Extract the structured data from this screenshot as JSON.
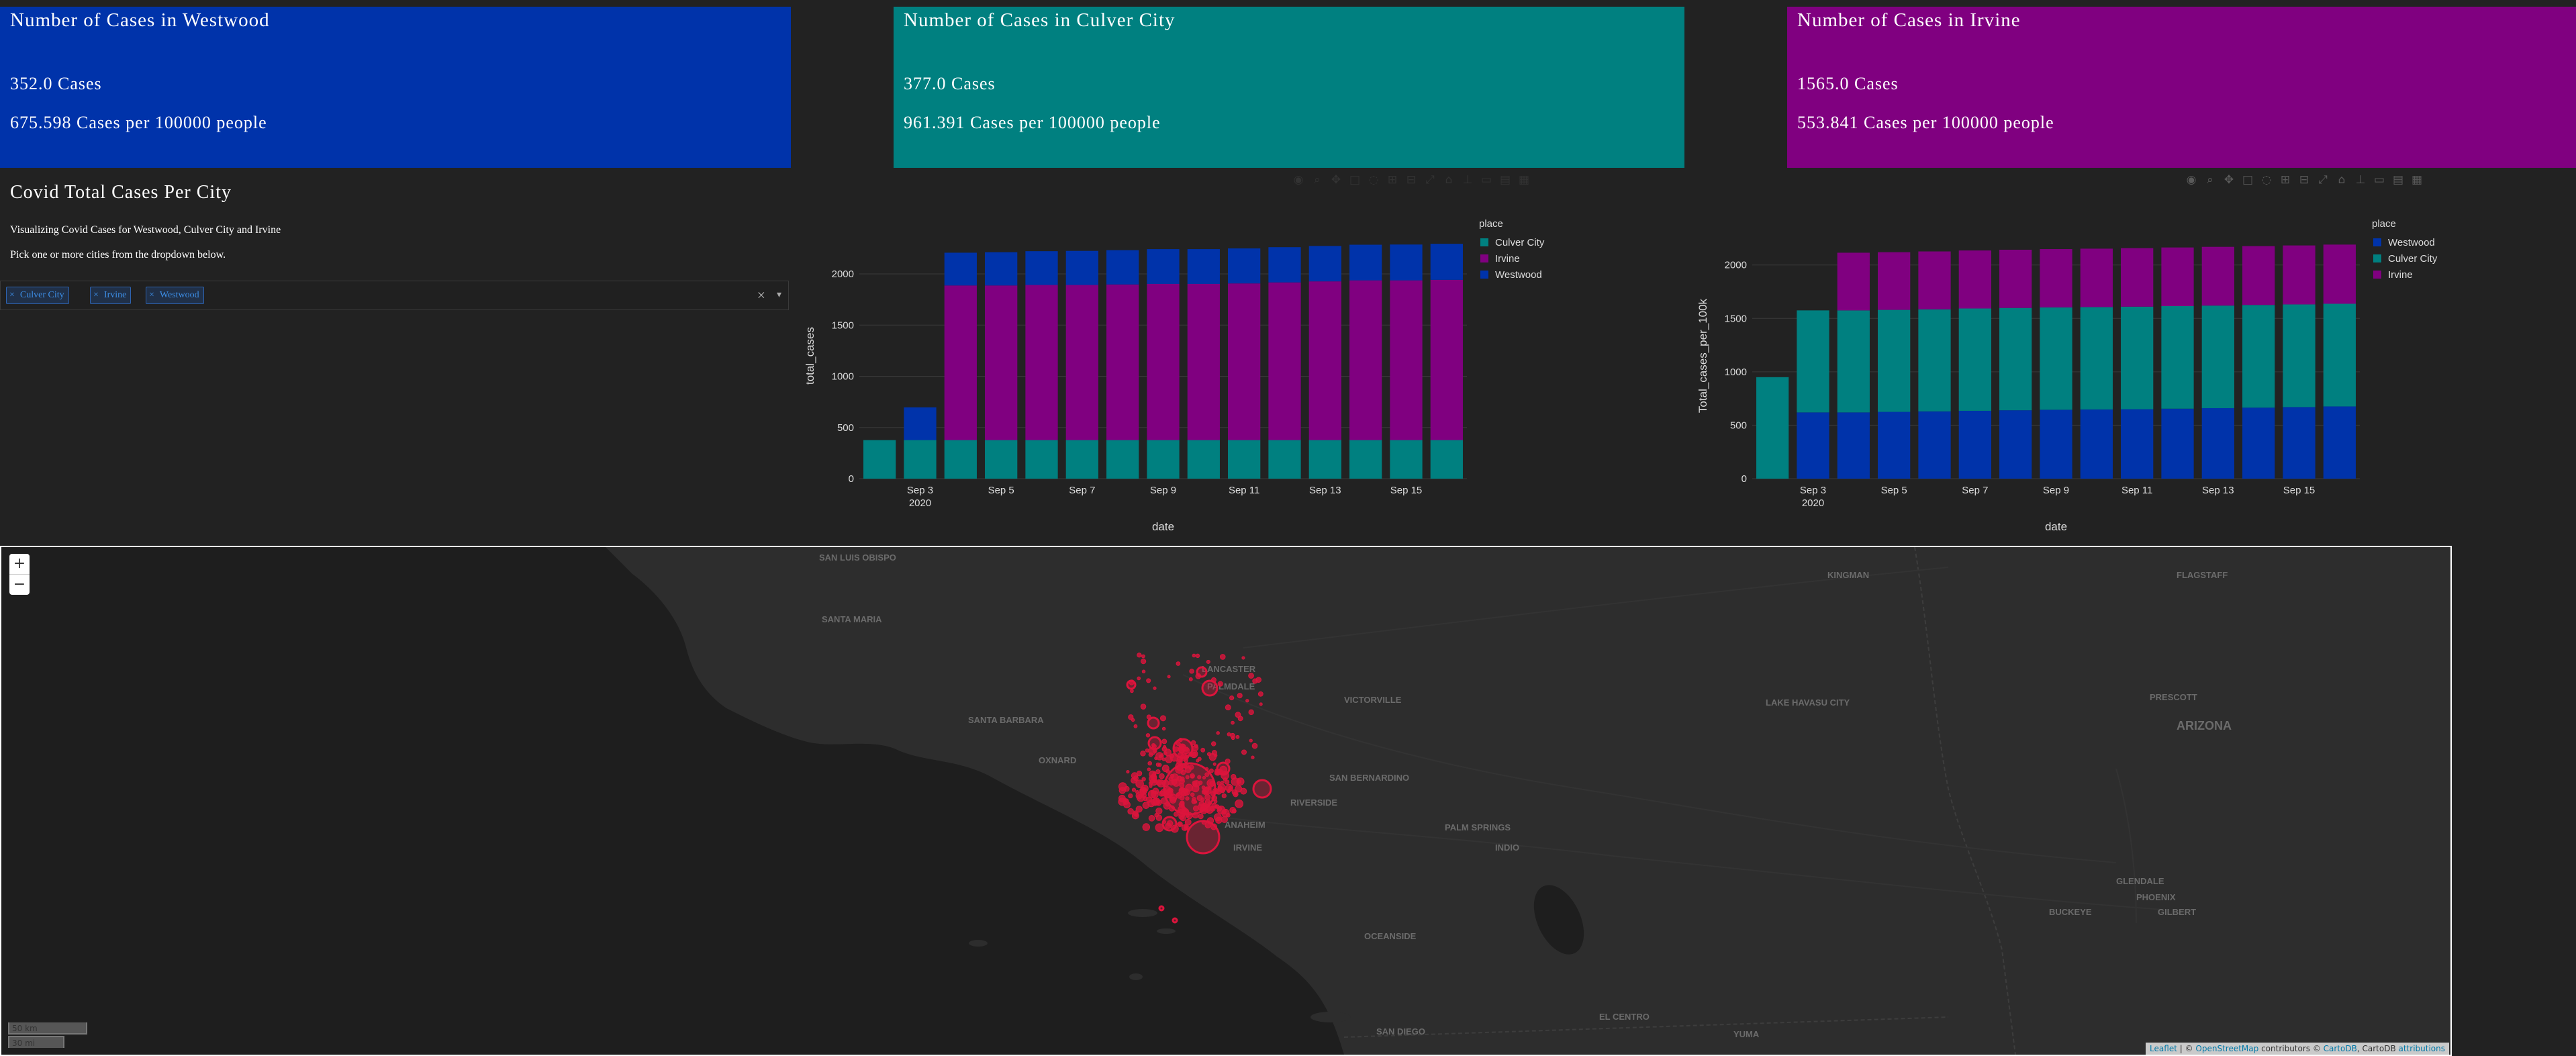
{
  "cards": [
    {
      "title": "Number of Cases in Westwood",
      "cases": "352.0 Cases",
      "per": "675.598 Cases per 100000 people",
      "color": "#0033aa"
    },
    {
      "title": "Number of Cases in Culver City",
      "cases": "377.0 Cases",
      "per": "961.391 Cases per 100000 people",
      "color": "#008080"
    },
    {
      "title": "Number of Cases in Irvine",
      "cases": "1565.0 Cases",
      "per": "553.841 Cases per 100000 people",
      "color": "#800080"
    }
  ],
  "intro": {
    "title": "Covid Total Cases Per City",
    "line1": "Visualizing Covid Cases for Westwood, Culver City and Irvine",
    "line2": "Pick one or more cities from the dropdown below."
  },
  "dropdown": {
    "chips": [
      "Culver City",
      "Irvine",
      "Westwood"
    ],
    "remove_glyph": "×",
    "clear_glyph": "×",
    "caret_glyph": "▾"
  },
  "colors": {
    "westwood": "#0033aa",
    "culver": "#008080",
    "irvine": "#800080"
  },
  "chart_data": [
    {
      "type": "bar",
      "stacked": true,
      "xlabel": "date",
      "ylabel": "total_cases",
      "legend_title": "place",
      "legend_position": "top-right",
      "grid": true,
      "ylim": [
        0,
        2400
      ],
      "yticks": [
        0,
        500,
        1000,
        1500,
        2000
      ],
      "x_tick_labels": [
        "Sep 3\n2020",
        "Sep 5",
        "Sep 7",
        "Sep 9",
        "Sep 11",
        "Sep 13",
        "Sep 15"
      ],
      "x_tick_days": [
        3,
        5,
        7,
        9,
        11,
        13,
        15
      ],
      "x": [
        "2020-09-02",
        "2020-09-03",
        "2020-09-04",
        "2020-09-05",
        "2020-09-06",
        "2020-09-07",
        "2020-09-08",
        "2020-09-09",
        "2020-09-10",
        "2020-09-11",
        "2020-09-12",
        "2020-09-13",
        "2020-09-14",
        "2020-09-15",
        "2020-09-16"
      ],
      "series": [
        {
          "name": "Culver City",
          "color": "#008080",
          "values": [
            377,
            377,
            377,
            377,
            377,
            377,
            377,
            377,
            377,
            377,
            377,
            377,
            377,
            377,
            377
          ]
        },
        {
          "name": "Irvine",
          "color": "#800080",
          "values": [
            0,
            0,
            1510,
            1510,
            1515,
            1515,
            1520,
            1525,
            1525,
            1530,
            1540,
            1550,
            1560,
            1560,
            1565
          ]
        },
        {
          "name": "Westwood",
          "color": "#0033aa",
          "values": [
            0,
            320,
            320,
            325,
            330,
            333,
            335,
            340,
            340,
            342,
            344,
            346,
            348,
            350,
            352
          ]
        }
      ]
    },
    {
      "type": "bar",
      "stacked": true,
      "xlabel": "date",
      "ylabel": "Total_cases_per_100k",
      "legend_title": "place",
      "legend_position": "top-right",
      "grid": true,
      "ylim": [
        0,
        2300
      ],
      "yticks": [
        0,
        500,
        1000,
        1500,
        2000
      ],
      "x_tick_labels": [
        "Sep 3\n2020",
        "Sep 5",
        "Sep 7",
        "Sep 9",
        "Sep 11",
        "Sep 13",
        "Sep 15"
      ],
      "x_tick_days": [
        3,
        5,
        7,
        9,
        11,
        13,
        15
      ],
      "x": [
        "2020-09-02",
        "2020-09-03",
        "2020-09-04",
        "2020-09-05",
        "2020-09-06",
        "2020-09-07",
        "2020-09-08",
        "2020-09-09",
        "2020-09-10",
        "2020-09-11",
        "2020-09-12",
        "2020-09-13",
        "2020-09-14",
        "2020-09-15",
        "2020-09-16"
      ],
      "series": [
        {
          "name": "Westwood",
          "color": "#0033aa",
          "values": [
            0,
            620,
            620,
            625,
            630,
            635,
            640,
            645,
            648,
            650,
            655,
            660,
            665,
            670,
            676
          ]
        },
        {
          "name": "Culver City",
          "color": "#008080",
          "values": [
            950,
            955,
            955,
            955,
            955,
            958,
            958,
            958,
            958,
            960,
            960,
            960,
            961,
            961,
            961
          ]
        },
        {
          "name": "Irvine",
          "color": "#800080",
          "values": [
            0,
            0,
            540,
            540,
            542,
            543,
            545,
            546,
            547,
            548,
            549,
            550,
            551,
            552,
            554
          ]
        }
      ]
    }
  ],
  "modebar_icons": [
    "camera-icon",
    "zoom-icon",
    "pan-icon",
    "box-select-icon",
    "lasso-icon",
    "zoom-in-icon",
    "zoom-out-icon",
    "autoscale-icon",
    "home-icon",
    "spike-icon",
    "hover-closest-icon",
    "hover-compare-icon",
    "plotly-logo-icon"
  ],
  "map": {
    "zoom_in": "+",
    "zoom_out": "−",
    "scale_km": "50 km",
    "scale_mi": "30 mi",
    "attribution": {
      "leaflet": "Leaflet",
      "sep": " | © ",
      "osm": "OpenStreetMap",
      "mid": " contributors © ",
      "carto": "CartoDB",
      "sep2": ", CartoDB ",
      "attr": "attributions"
    },
    "marker_color": "#dc143c",
    "labels": [
      {
        "text": "SAN LUIS OBISPO"
      },
      {
        "text": "SANTA MARIA"
      },
      {
        "text": "LANCASTER"
      },
      {
        "text": "PALMDALE"
      },
      {
        "text": "SANTA BARBARA"
      },
      {
        "text": "VICTORVILLE"
      },
      {
        "text": "SAN BERNARDINO"
      },
      {
        "text": "RIVERSIDE"
      },
      {
        "text": "ANAHEIM"
      },
      {
        "text": "IRVINE"
      },
      {
        "text": "PALM SPRINGS"
      },
      {
        "text": "INDIO"
      },
      {
        "text": "OCEANSIDE"
      },
      {
        "text": "SAN DIEGO"
      },
      {
        "text": "EL CENTRO"
      },
      {
        "text": "YUMA"
      },
      {
        "text": "KINGMAN"
      },
      {
        "text": "FLAGSTAFF"
      },
      {
        "text": "PRESCOTT"
      },
      {
        "text": "ARIZONA"
      },
      {
        "text": "PHOENIX"
      },
      {
        "text": "LAKE HAVASU CITY"
      },
      {
        "text": "BUCKEYE"
      },
      {
        "text": "GLENDALE"
      },
      {
        "text": "GILBERT"
      },
      {
        "text": "OXNARD"
      }
    ]
  }
}
